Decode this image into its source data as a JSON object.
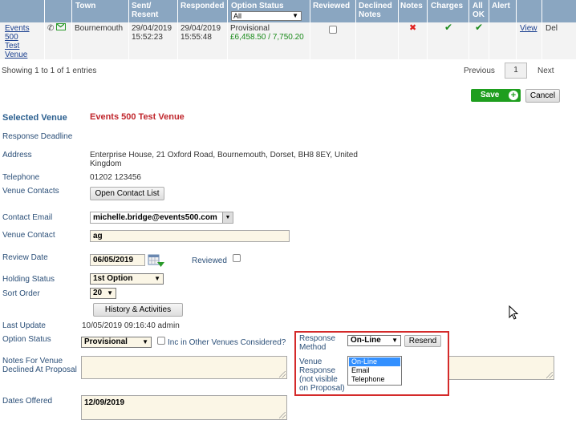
{
  "table": {
    "headers": {
      "town": "Town",
      "sent": "Sent/\nResent",
      "responded": "Responded",
      "option_status": "Option Status",
      "option_filter": "All",
      "reviewed": "Reviewed",
      "declined_notes": "Declined\nNotes",
      "notes": "Notes",
      "charges": "Charges",
      "all_ok": "All\nOK",
      "alert": "Alert"
    },
    "row": {
      "venue_link": "Events\n500\nTest\nVenue",
      "town": "Bournemouth",
      "sent": "29/04/2019\n15:52:23",
      "responded": "29/04/2019\n15:55:48",
      "status": "Provisional",
      "amount": "£6,458.50 / 7,750.20",
      "notes_mark": "✖",
      "charges_mark": "✔",
      "all_ok_mark": "✔",
      "view": "View",
      "del": "Del"
    }
  },
  "pagination": {
    "info": "Showing 1 to 1 of 1 entries",
    "previous": "Previous",
    "page": "1",
    "next": "Next"
  },
  "actions": {
    "save": "Save",
    "cancel": "Cancel"
  },
  "form": {
    "selected_venue_label": "Selected Venue",
    "selected_venue_value": "Events 500 Test Venue",
    "response_deadline_label": "Response Deadline",
    "address_label": "Address",
    "address_value": "Enterprise House, 21 Oxford Road, Bournemouth, Dorset, BH8 8EY, United\nKingdom",
    "telephone_label": "Telephone",
    "telephone_value": "01202 123456",
    "venue_contacts_label": "Venue Contacts",
    "open_contact_list": "Open Contact List",
    "contact_email_label": "Contact Email",
    "contact_email_value": "michelle.bridge@events500.com",
    "venue_contact_label": "Venue Contact",
    "venue_contact_value": "ag",
    "review_date_label": "Review Date",
    "review_date_value": "06/05/2019",
    "reviewed_label": "Reviewed",
    "holding_status_label": "Holding Status",
    "holding_status_value": "1st Option",
    "sort_order_label": "Sort Order",
    "sort_order_value": "20",
    "history_button": "History & Activities",
    "last_update_label": "Last Update",
    "last_update_value": "10/05/2019 09:16:40 admin",
    "option_status_label": "Option Status",
    "option_status_value": "Provisional",
    "inc_other_label": "Inc in Other Venues Considered?",
    "notes_declined_label": "Notes For Venue\nDeclined At Proposal",
    "dates_offered_label": "Dates Offered",
    "dates_offered_value": "12/09/2019"
  },
  "response": {
    "method_label": "Response\nMethod",
    "method_value": "On-Line",
    "resend": "Resend",
    "venue_response_label": "Venue\nResponse\n(not visible\non Proposal)",
    "options": [
      "On-Line",
      "Email",
      "Telephone"
    ]
  },
  "colors": {
    "header_bg": "#8aa6c1",
    "accent_red": "#c0272d",
    "save_green": "#1e9e1e",
    "highlight_border": "#d42a2a",
    "field_bg": "#fbf6e6"
  }
}
